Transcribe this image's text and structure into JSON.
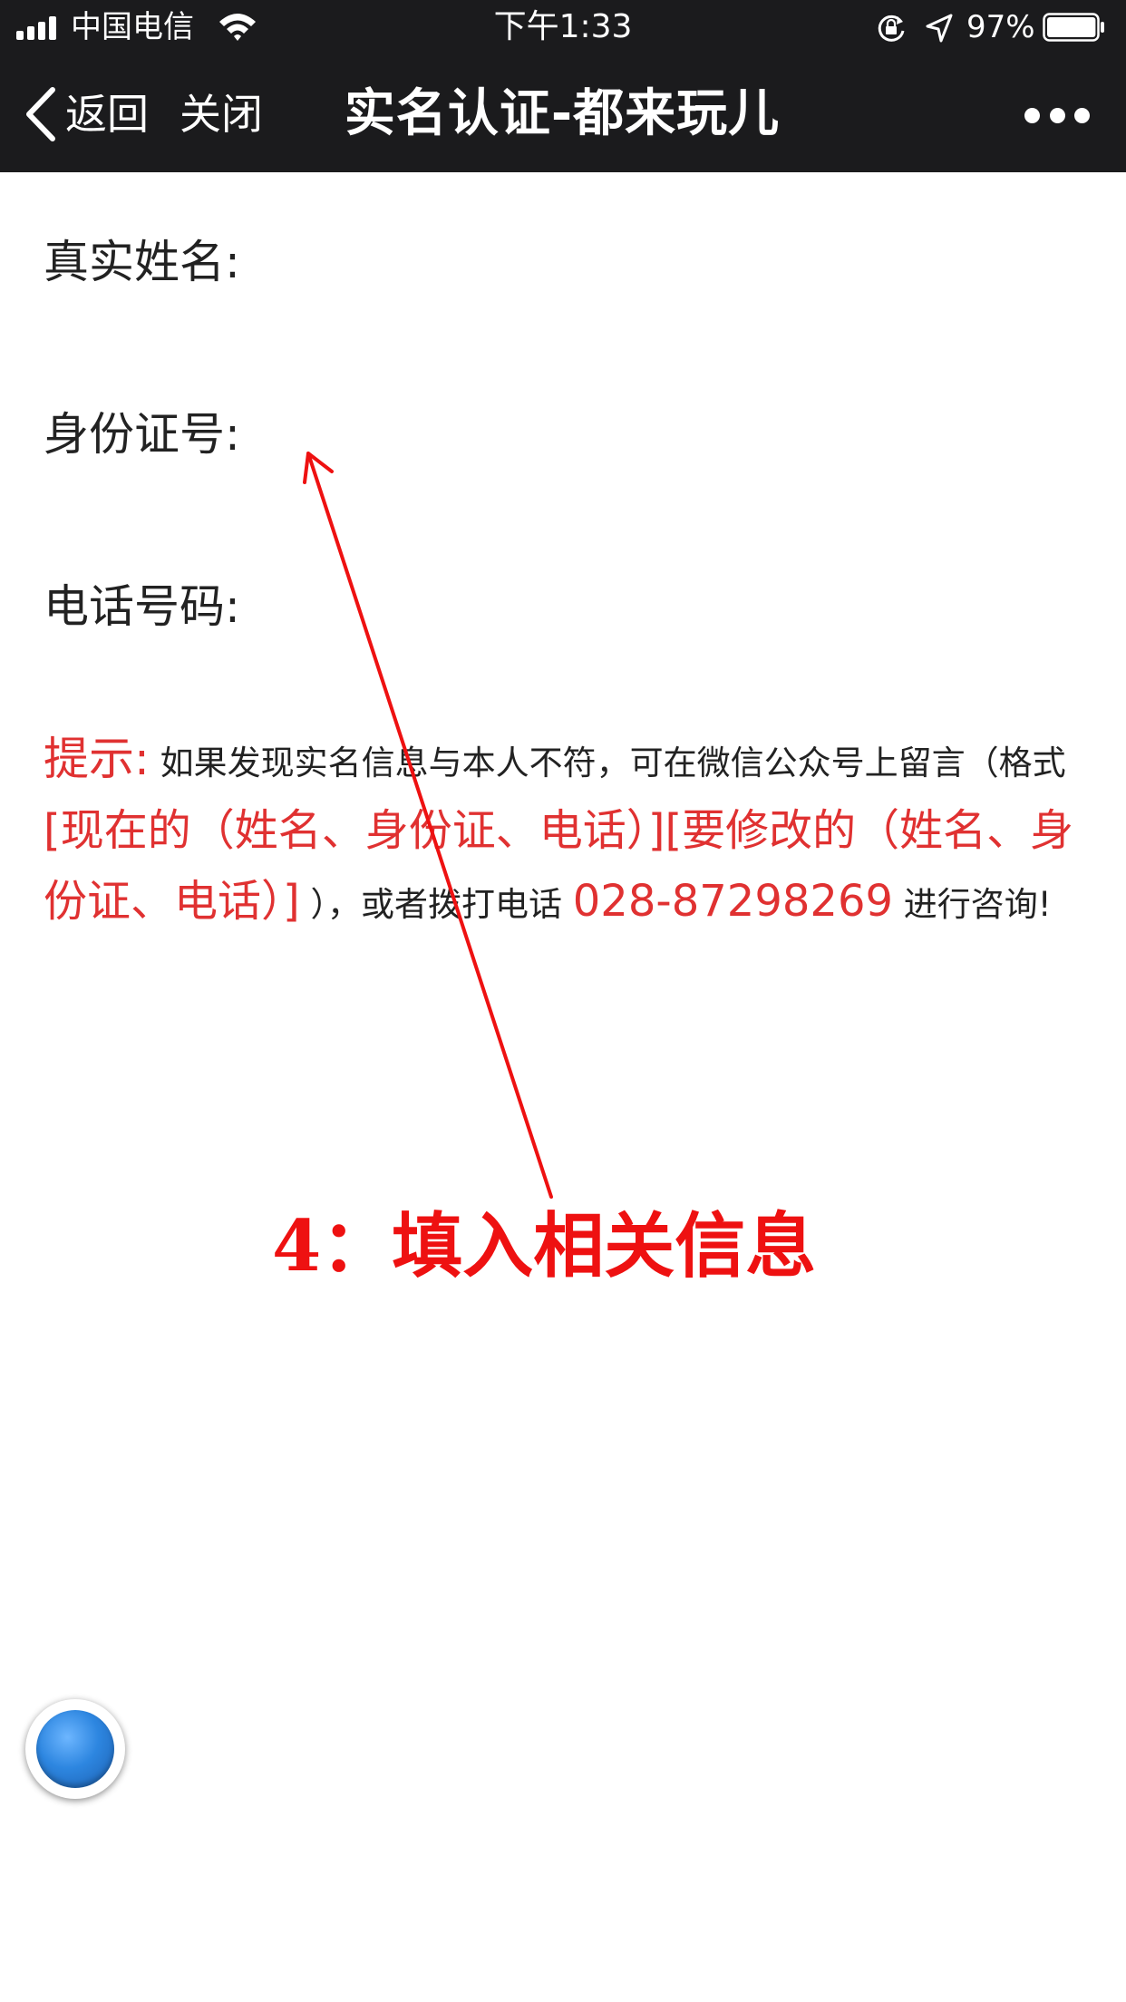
{
  "status_bar": {
    "carrier": "中国电信",
    "time": "下午1:33",
    "battery_percent": "97%",
    "battery_level": 0.97
  },
  "nav": {
    "back_label": "返回",
    "close_label": "关闭",
    "title": "实名认证-都来玩儿"
  },
  "form": {
    "name_label": "真实姓名:",
    "id_label": "身份证号:",
    "phone_label": "电话号码:",
    "name_value": "",
    "id_value": "",
    "phone_value": ""
  },
  "notice": {
    "title": "提示:",
    "text1": "如果发现实名信息与本人不符，可在微信公众号上留言（格式",
    "format": "[现在的（姓名、身份证、电话）][要修改的（姓名、身份证、电话）]",
    "text2": "），或者拨打电话",
    "phone": "028-87298269",
    "text3": "进行咨询!"
  },
  "annotation": {
    "text": "4：填入相关信息",
    "color": "#ee1111"
  },
  "colors": {
    "topbar": "#1b1b1d",
    "notice_red": "#e03131",
    "float_ball": "#2d86e0"
  }
}
